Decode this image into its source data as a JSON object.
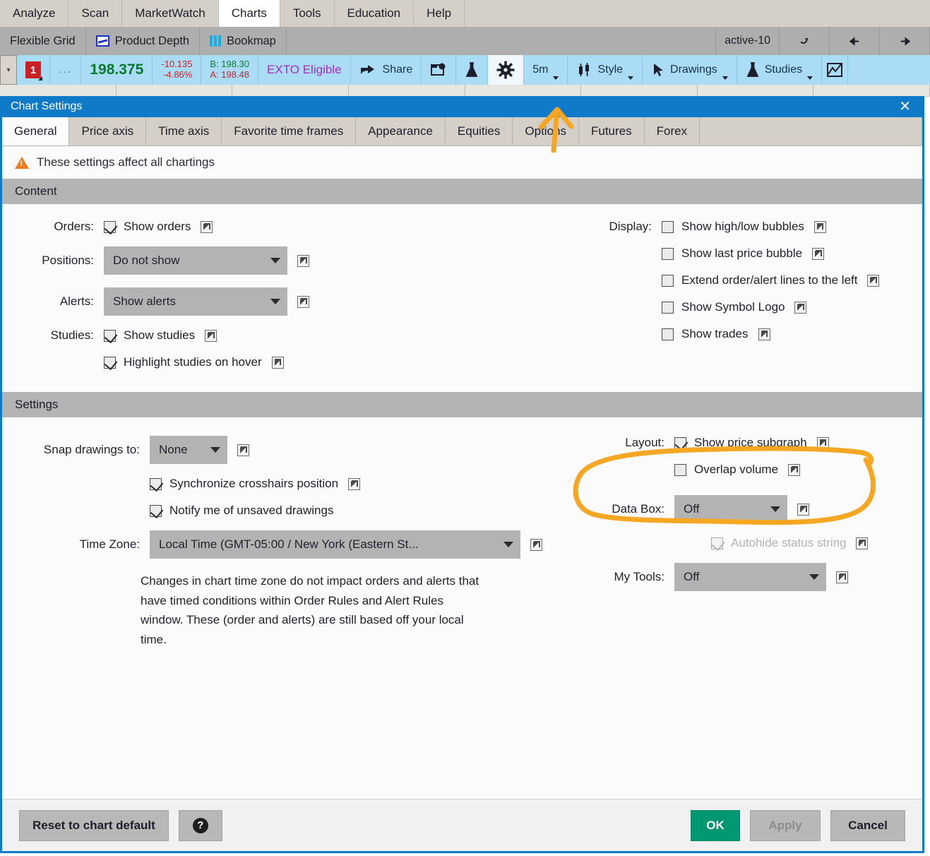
{
  "menubar": {
    "items": [
      {
        "label": "Analyze",
        "active": false
      },
      {
        "label": "Scan",
        "active": false
      },
      {
        "label": "MarketWatch",
        "active": false
      },
      {
        "label": "Charts",
        "active": true
      },
      {
        "label": "Tools",
        "active": false
      },
      {
        "label": "Education",
        "active": false
      },
      {
        "label": "Help",
        "active": false
      }
    ]
  },
  "toolbar2": {
    "flexible_grid": "Flexible Grid",
    "product_depth": "Product Depth",
    "bookmap": "Bookmap",
    "active_label": "active-10",
    "undo_icon": "undo-icon",
    "back_icon": "arrow-left-icon",
    "forward_icon": "arrow-right-icon"
  },
  "ticker": {
    "badge": "1",
    "dots": "...",
    "last_price": "198.375",
    "change_abs": "-10.135",
    "change_pct": "-4.86%",
    "bid": "B: 198.30",
    "ask": "A: 198.48",
    "exto": "EXTO Eligible",
    "share": "Share",
    "timeframe": "5m",
    "style": "Style",
    "drawings": "Drawings",
    "studies": "Studies",
    "icons": {
      "note_icon": "note-icon",
      "flask_icon": "flask-icon",
      "gear_icon": "gear-icon",
      "style_icon": "candlestick-icon",
      "cursor_icon": "cursor-arrow-icon",
      "chart_type_icon": "chart-type-icon"
    }
  },
  "dialog": {
    "title": "Chart Settings",
    "close_icon": "close-icon",
    "tabs": [
      {
        "label": "General",
        "active": true
      },
      {
        "label": "Price axis",
        "active": false
      },
      {
        "label": "Time axis",
        "active": false
      },
      {
        "label": "Favorite time frames",
        "active": false
      },
      {
        "label": "Appearance",
        "active": false
      },
      {
        "label": "Equities",
        "active": false
      },
      {
        "label": "Options",
        "active": false
      },
      {
        "label": "Futures",
        "active": false
      },
      {
        "label": "Forex",
        "active": false
      }
    ],
    "warning": "These settings affect all chartings",
    "content": {
      "header": "Content",
      "orders_label": "Orders:",
      "orders_checkbox": {
        "label": "Show orders",
        "checked": true
      },
      "positions_label": "Positions:",
      "positions_value": "Do not show",
      "alerts_label": "Alerts:",
      "alerts_value": "Show alerts",
      "studies_label": "Studies:",
      "studies_checkbox": {
        "label": "Show studies",
        "checked": true
      },
      "highlight_checkbox": {
        "label": "Highlight studies on hover",
        "checked": true
      },
      "display_label": "Display:",
      "display_items": [
        {
          "label": "Show high/low bubbles",
          "checked": false
        },
        {
          "label": "Show last price bubble",
          "checked": false
        },
        {
          "label": "Extend order/alert lines to the left",
          "checked": false
        },
        {
          "label": "Show Symbol Logo",
          "checked": false
        },
        {
          "label": "Show trades",
          "checked": false
        }
      ]
    },
    "settings": {
      "header": "Settings",
      "snap_label": "Snap drawings to:",
      "snap_value": "None",
      "sync_checkbox": {
        "label": "Synchronize crosshairs position",
        "checked": true
      },
      "notify_checkbox": {
        "label": "Notify me of unsaved drawings",
        "checked": true
      },
      "timezone_label": "Time Zone:",
      "timezone_value": "Local Time (GMT-05:00 / New York (Eastern St...",
      "timezone_note": "Changes in chart time zone do not impact orders and alerts that have timed conditions within Order Rules and Alert Rules window. These (order and alerts) are still based off your local time.",
      "layout_label": "Layout:",
      "layout_items": [
        {
          "label": "Show price subgraph",
          "checked": true
        },
        {
          "label": "Overlap volume",
          "checked": false
        }
      ],
      "databox_label": "Data Box:",
      "databox_value": "Off",
      "autohide_checkbox": {
        "label": "Autohide status string",
        "checked": true,
        "disabled": true
      },
      "mytools_label": "My Tools:",
      "mytools_value": "Off"
    },
    "footer": {
      "reset_label": "Reset to chart default",
      "help_icon": "help-icon",
      "ok_label": "OK",
      "apply_label": "Apply",
      "cancel_label": "Cancel"
    }
  },
  "annotations": {
    "highlight_color": "#f5a623",
    "ellipse_target": "layout-group",
    "arrow_target": "gear-icon"
  }
}
